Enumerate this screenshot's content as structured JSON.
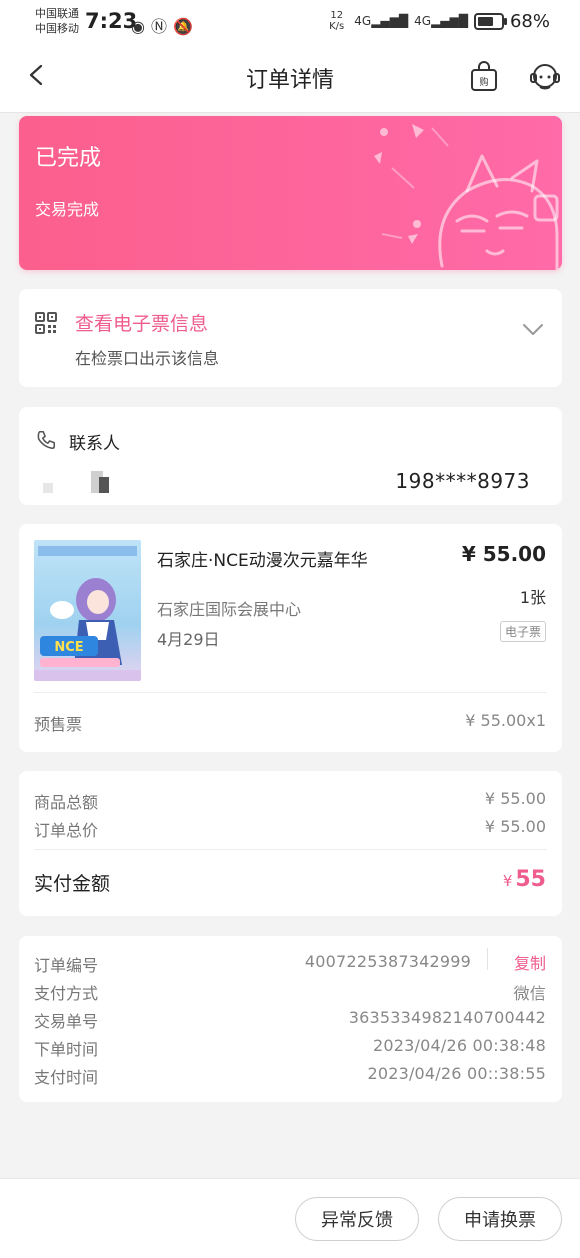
{
  "status_bar": {
    "carrier_1": "中国联通",
    "carrier_2": "中国移动",
    "time": "7:23",
    "speed_value": "12",
    "speed_unit": "K/s",
    "signal_1": "4G",
    "signal_2": "4G",
    "battery_percent": "68%",
    "battery_level": 0.68
  },
  "nav": {
    "title": "订单详情"
  },
  "order_status": {
    "title": "已完成",
    "subtitle": "交易完成"
  },
  "eticket": {
    "title": "查看电子票信息",
    "subtitle": "在检票口出示该信息"
  },
  "contact": {
    "label": "联系人",
    "phone": "198****8973"
  },
  "product": {
    "name": "石家庄·NCE动漫次元嘉年华",
    "price": "¥ 55.00",
    "venue": "石家庄国际会展中心",
    "quantity": "1张",
    "date": "4月29日",
    "tag": "电子票",
    "ticket_type": "预售票",
    "line_price": "¥ 55.00x1"
  },
  "amounts": {
    "goods_total_label": "商品总额",
    "goods_total": "¥ 55.00",
    "order_total_label": "订单总价",
    "order_total": "¥ 55.00",
    "paid_label": "实付金额",
    "paid_currency": "¥",
    "paid_amount": "55"
  },
  "order_info": {
    "order_no_label": "订单编号",
    "order_no": "4007225387342999",
    "copy_label": "复制",
    "pay_method_label": "支付方式",
    "pay_method": "微信",
    "trade_no_label": "交易单号",
    "trade_no": "3635334982140700442",
    "order_time_label": "下单时间",
    "order_time": "2023/04/26 00:38:48",
    "pay_time_label": "支付时间",
    "pay_time": "2023/04/26 00::38:55"
  },
  "actions": {
    "feedback": "异常反馈",
    "exchange": "申请换票"
  },
  "colors": {
    "accent": "#ef5d8e",
    "status_gradient_start": "#fb5f8d",
    "status_gradient_end": "#ff6aa8"
  }
}
